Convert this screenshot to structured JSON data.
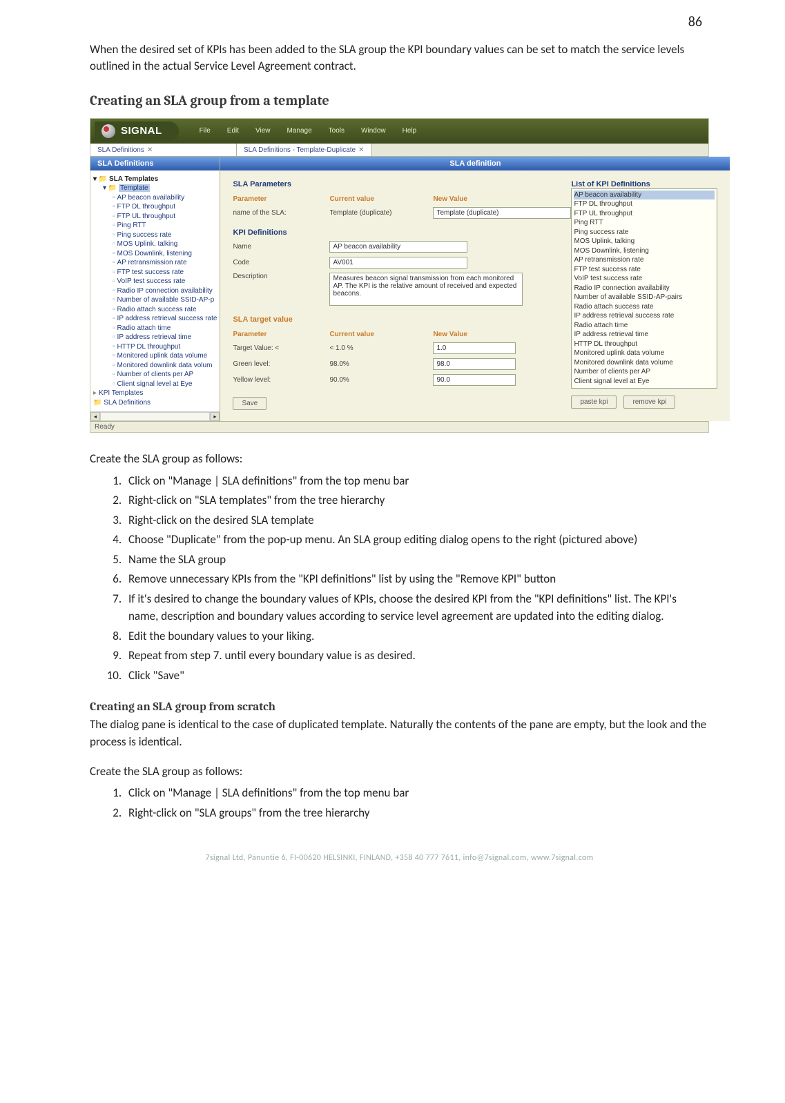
{
  "page_number": "86",
  "intro_text": "When the desired set of KPIs has been added to the SLA group the KPI boundary values can be set to match the service levels outlined in the actual Service Level Agreement contract.",
  "section_title_1": "Creating an SLA group from a template",
  "screenshot": {
    "brand": "SIGNAL",
    "menus": [
      "File",
      "Edit",
      "View",
      "Manage",
      "Tools",
      "Window",
      "Help"
    ],
    "tab_left": "SLA Definitions",
    "tab_right": "SLA Definitions - Template-Duplicate",
    "left_header": "SLA Definitions",
    "right_header": "SLA definition",
    "tree": {
      "root": "SLA Templates",
      "template_node": "Template",
      "items": [
        "AP beacon availability",
        "FTP DL throughput",
        "FTP UL throughput",
        "Ping RTT",
        "Ping success rate",
        "MOS Uplink, talking",
        "MOS Downlink, listening",
        "AP retransmission rate",
        "FTP test success rate",
        "VoIP test success rate",
        "Radio IP connection availability",
        "Number of available SSID-AP-p",
        "Radio attach success rate",
        "IP address retrieval success rate",
        "Radio attach time",
        "IP address retrieval time",
        "HTTP DL throughput",
        "Monitored uplink data volume",
        "Monitored downlink data volum",
        "Number of clients per AP",
        "Client signal level at Eye"
      ],
      "branch1": "KPI Templates",
      "branch2": "SLA Definitions"
    },
    "form": {
      "sla_params_heading": "SLA Parameters",
      "param_label": "Parameter",
      "current_label": "Current value",
      "new_label": "New Value",
      "name_of_sla_label": "name of the SLA:",
      "name_of_sla_current": "Template (duplicate)",
      "name_of_sla_new": "Template (duplicate)",
      "kpi_def_heading": "KPI Definitions",
      "name_label": "Name",
      "name_value": "AP beacon availability",
      "code_label": "Code",
      "code_value": "AV001",
      "desc_label": "Description",
      "desc_value": "Measures beacon signal transmission from each monitored AP. The KPI is the relative amount of received and expected beacons.",
      "target_heading": "SLA target value",
      "target_value_label": "Target Value: <",
      "target_value_current": "< 1.0 %",
      "target_value_new": "1.0",
      "green_label": "Green level:",
      "green_current": "98.0%",
      "green_new": "98.0",
      "yellow_label": "Yellow level:",
      "yellow_current": "90.0%",
      "yellow_new": "90.0",
      "list_heading": "List of KPI Definitions",
      "list_items": [
        "AP beacon availability",
        "FTP DL throughput",
        "FTP UL throughput",
        "Ping RTT",
        "Ping success rate",
        "MOS Uplink, talking",
        "MOS Downlink, listening",
        "AP retransmission rate",
        "FTP test success rate",
        "VoIP test success rate",
        "Radio IP connection availability",
        "Number of available SSID-AP-pairs",
        "Radio attach success rate",
        "IP address retrieval success rate",
        "Radio attach time",
        "IP address retrieval time",
        "HTTP DL throughput",
        "Monitored uplink data volume",
        "Monitored downlink data volume",
        "Number of clients per AP",
        "Client signal level at Eye"
      ],
      "btn_paste": "paste kpi",
      "btn_remove": "remove kpi",
      "btn_save": "Save"
    },
    "status": "Ready"
  },
  "steps_intro_1": "Create the SLA group as follows:",
  "steps_1": [
    "Click on \"Manage | SLA definitions\" from the top menu bar",
    "Right-click on \"SLA templates\" from the tree hierarchy",
    "Right-click on the desired SLA template",
    "Choose \"Duplicate\" from the pop-up menu. An SLA group editing dialog opens to the right (pictured above)",
    "Name the SLA group",
    "Remove unnecessary KPIs from the \"KPI definitions\" list by using the \"Remove KPI\" button",
    "If it's desired to change the boundary values of KPIs, choose the desired KPI from the \"KPI definitions\" list. The KPI's name, description and boundary values according to service level agreement are updated into the editing dialog.",
    "Edit the boundary values to your liking.",
    "Repeat from step 7. until every boundary value is as desired.",
    "Click \"Save\""
  ],
  "section_title_2": "Creating an SLA group from scratch",
  "scratch_text": "The dialog pane is identical to the case of duplicated template. Naturally the contents of the pane are empty, but the look and the process is identical.",
  "steps_intro_2": "Create the SLA group as follows:",
  "steps_2": [
    "Click on \"Manage | SLA definitions\" from the top menu bar",
    "Right-click on \"SLA groups\" from the tree hierarchy"
  ],
  "footer": "7signal Ltd, Panuntie 6, FI-00620 HELSINKI, FINLAND, +358 40 777 7611, info@7signal.com, www.7signal.com"
}
